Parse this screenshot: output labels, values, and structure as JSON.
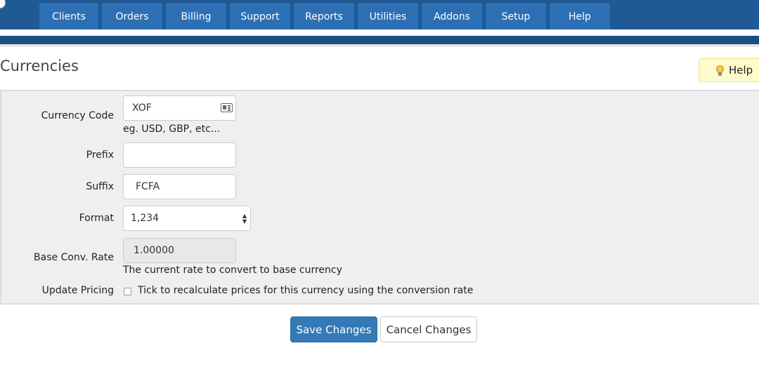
{
  "nav": {
    "tabs": [
      {
        "label": "Clients"
      },
      {
        "label": "Orders"
      },
      {
        "label": "Billing"
      },
      {
        "label": "Support"
      },
      {
        "label": "Reports"
      },
      {
        "label": "Utilities"
      },
      {
        "label": "Addons"
      },
      {
        "label": "Setup"
      },
      {
        "label": "Help"
      }
    ]
  },
  "page": {
    "title": "Currencies",
    "help_label": "Help"
  },
  "form": {
    "currency_code": {
      "label": "Currency Code",
      "value": "XOF",
      "hint": "eg. USD, GBP, etc..."
    },
    "prefix": {
      "label": "Prefix",
      "value": ""
    },
    "suffix": {
      "label": "Suffix",
      "value": "FCFA"
    },
    "format": {
      "label": "Format",
      "selected": "1,234"
    },
    "base_rate": {
      "label": "Base Conv. Rate",
      "value": "1.00000",
      "hint": "The current rate to convert to base currency"
    },
    "update_pricing": {
      "label": "Update Pricing",
      "checkbox_label": "Tick to recalculate prices for this currency using the conversion rate",
      "checked": false
    }
  },
  "actions": {
    "save_label": "Save Changes",
    "cancel_label": "Cancel Changes"
  },
  "colors": {
    "nav_bg": "#1f5a96",
    "tab_bg": "#2c6fb4",
    "primary": "#337ab7",
    "help_bg": "#fffbcc"
  }
}
